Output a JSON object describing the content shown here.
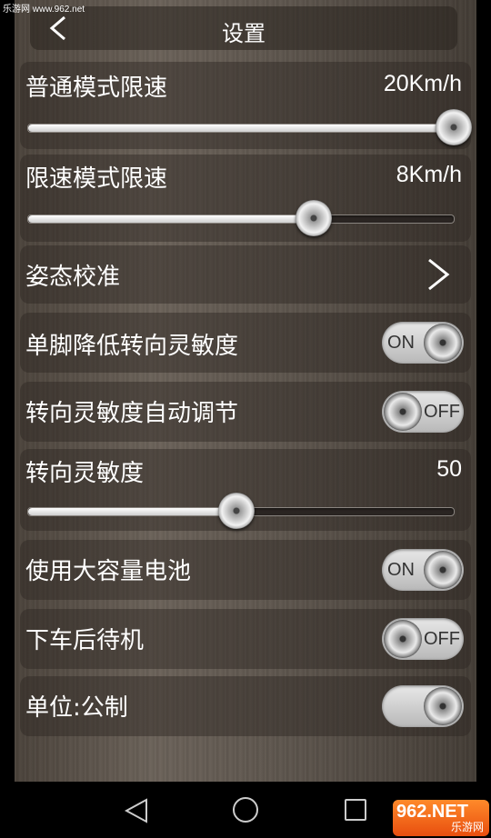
{
  "watermark_top": "乐游网 www.962.net",
  "header": {
    "title": "设置"
  },
  "normal_speed": {
    "label": "普通模式限速",
    "value": "20Km/h",
    "level": 1.0
  },
  "limit_speed": {
    "label": "限速模式限速",
    "value": "8Km/h",
    "level": 0.67
  },
  "calibration": {
    "label": "姿态校准"
  },
  "single_foot": {
    "label": "单脚降低转向灵敏度",
    "state": "ON"
  },
  "auto_steer": {
    "label": "转向灵敏度自动调节",
    "state": "OFF"
  },
  "steer_sensitivity": {
    "label": "转向灵敏度",
    "value": "50",
    "level": 0.49
  },
  "big_battery": {
    "label": "使用大容量电池",
    "state": "ON"
  },
  "standby": {
    "label": "下车后待机",
    "state": "OFF"
  },
  "unit": {
    "label": "单位:公制",
    "state": ""
  },
  "logo": {
    "main": "962.NET",
    "sub": "乐游网"
  },
  "icons": [
    "back-icon",
    "chevron-right-icon",
    "nav-back-icon",
    "nav-home-icon",
    "nav-recent-icon"
  ]
}
